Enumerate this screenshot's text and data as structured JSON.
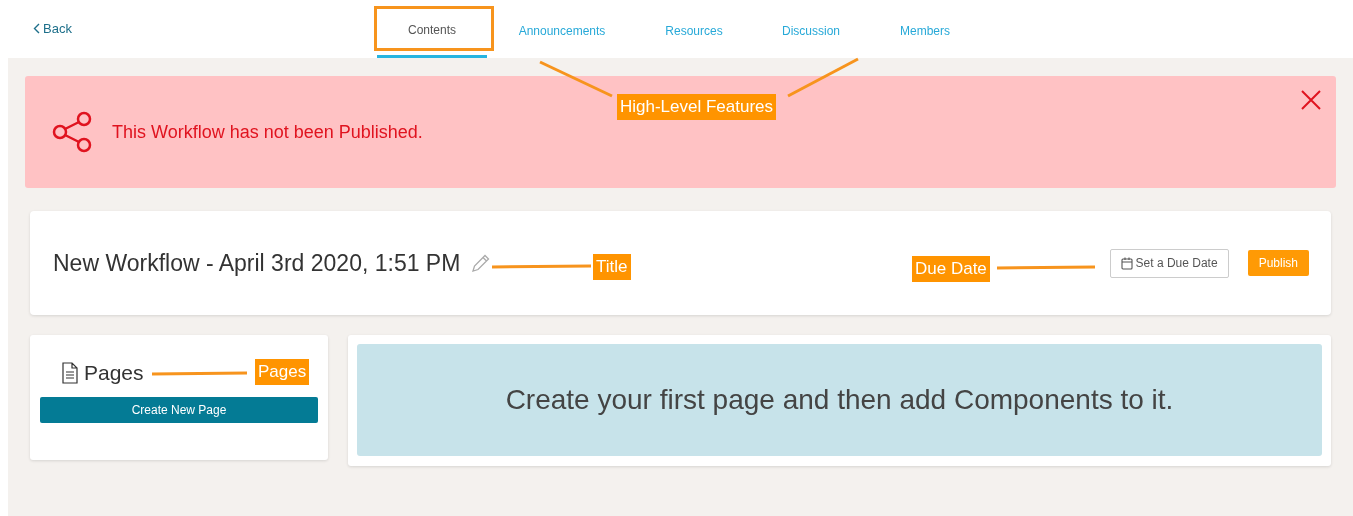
{
  "nav": {
    "back": "Back",
    "tabs": [
      {
        "label": "Contents",
        "selected": true
      },
      {
        "label": "Announcements",
        "selected": false
      },
      {
        "label": "Resources",
        "selected": false
      },
      {
        "label": "Discussion",
        "selected": false
      },
      {
        "label": "Members",
        "selected": false
      }
    ]
  },
  "alert": {
    "message": "This Workflow has not been Published.",
    "dismissible": true
  },
  "workflow": {
    "title": "New Workflow - April 3rd 2020, 1:51 PM",
    "due_date_button": "Set a Due Date",
    "publish_button": "Publish"
  },
  "pages": {
    "heading": "Pages",
    "create_button": "Create New Page"
  },
  "empty_state": {
    "message": "Create your first page and then add Components to it."
  },
  "annotations": [
    {
      "label": "High-Level Features"
    },
    {
      "label": "Title"
    },
    {
      "label": "Due Date"
    },
    {
      "label": "Pages"
    }
  ]
}
